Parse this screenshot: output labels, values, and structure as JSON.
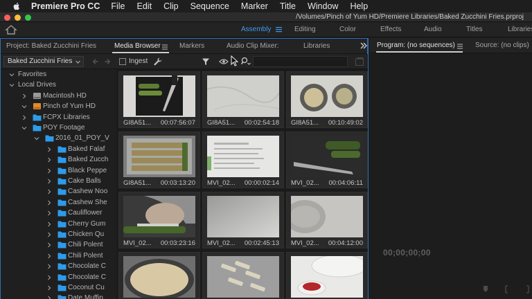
{
  "menubar": {
    "app_name": "Premiere Pro CC",
    "menus": [
      "File",
      "Edit",
      "Clip",
      "Sequence",
      "Marker",
      "Title",
      "Window",
      "Help"
    ]
  },
  "titlebar": {
    "path": "/Volumes/Pinch of Yum HD/Premiere Libraries/Baked Zucchini Fries.prproj"
  },
  "workspaces": {
    "tabs": [
      "Assembly",
      "Editing",
      "Color",
      "Effects",
      "Audio",
      "Titles",
      "Libraries"
    ],
    "active": "Assembly"
  },
  "project_panel": {
    "tabs": [
      "Project: Baked Zucchini Fries",
      "Media Browser",
      "Markers",
      "Audio Clip Mixer:",
      "Libraries"
    ],
    "active_tab": "Media Browser"
  },
  "media_browser": {
    "location": "Baked Zucchini Fries",
    "ingest_label": "Ingest",
    "search_value": ""
  },
  "tree": [
    {
      "label": "Favorites",
      "level": 0,
      "expanded": true,
      "type": "section"
    },
    {
      "label": "Local Drives",
      "level": 0,
      "expanded": true,
      "type": "section"
    },
    {
      "label": "Macintosh HD",
      "level": 1,
      "expanded": false,
      "type": "drive"
    },
    {
      "label": "Pinch of Yum HD",
      "level": 1,
      "expanded": true,
      "type": "drive-orange"
    },
    {
      "label": "FCPX Libraries",
      "level": 2,
      "expanded": false,
      "type": "folder"
    },
    {
      "label": "POY Footage",
      "level": 2,
      "expanded": true,
      "type": "folder"
    },
    {
      "label": "2016_01_POY_V",
      "level": 3,
      "expanded": true,
      "type": "folder"
    },
    {
      "label": "Baked Falaf",
      "level": 4,
      "expanded": false,
      "type": "folder"
    },
    {
      "label": "Baked Zucch",
      "level": 4,
      "expanded": false,
      "type": "folder"
    },
    {
      "label": "Black Peppe",
      "level": 4,
      "expanded": false,
      "type": "folder"
    },
    {
      "label": "Cake Balls",
      "level": 4,
      "expanded": false,
      "type": "folder"
    },
    {
      "label": "Cashew Noo",
      "level": 4,
      "expanded": false,
      "type": "folder"
    },
    {
      "label": "Cashew She",
      "level": 4,
      "expanded": false,
      "type": "folder"
    },
    {
      "label": "Cauliflower",
      "level": 4,
      "expanded": false,
      "type": "folder"
    },
    {
      "label": "Cherry Gum",
      "level": 4,
      "expanded": false,
      "type": "folder"
    },
    {
      "label": "Chicken Qu",
      "level": 4,
      "expanded": false,
      "type": "folder"
    },
    {
      "label": "Chili Polent",
      "level": 4,
      "expanded": false,
      "type": "folder"
    },
    {
      "label": "Chili Polent",
      "level": 4,
      "expanded": false,
      "type": "folder"
    },
    {
      "label": "Chocolate C",
      "level": 4,
      "expanded": false,
      "type": "folder"
    },
    {
      "label": "Chocolate C",
      "level": 4,
      "expanded": false,
      "type": "folder"
    },
    {
      "label": "Coconut Cu",
      "level": 4,
      "expanded": false,
      "type": "folder"
    },
    {
      "label": "Date Muffin",
      "level": 4,
      "expanded": false,
      "type": "folder"
    }
  ],
  "clips": [
    {
      "name": "GI8A51...",
      "duration": "00:07:56:07",
      "scene": "zucchini-knife"
    },
    {
      "name": "GI8A51...",
      "duration": "00:02:54:18",
      "scene": "marble"
    },
    {
      "name": "GI8A51...",
      "duration": "00:10:49:02",
      "scene": "bowls"
    },
    {
      "name": "GI8A51...",
      "duration": "00:03:13:20",
      "scene": "tray-fries"
    },
    {
      "name": "MVI_02...",
      "duration": "00:00:02:14",
      "scene": "recipe-paper"
    },
    {
      "name": "MVI_02...",
      "duration": "00:04:06:11",
      "scene": "knife-zucchini-dark"
    },
    {
      "name": "MVI_02...",
      "duration": "00:03:23:16",
      "scene": "cutting-hand"
    },
    {
      "name": "MVI_02...",
      "duration": "00:02:45:13",
      "scene": "blurry-light"
    },
    {
      "name": "MVI_02...",
      "duration": "00:04:12:00",
      "scene": "plate-blur"
    },
    {
      "name": "",
      "duration": "",
      "scene": "breadcrumbs-bowl"
    },
    {
      "name": "",
      "duration": "",
      "scene": "breaded-sticks"
    },
    {
      "name": "",
      "duration": "",
      "scene": "sauce-bowl"
    }
  ],
  "program_panel": {
    "tabs": [
      "Program: (no sequences)",
      "Source: (no clips)"
    ],
    "timecode": "00;00;00;00"
  },
  "colors": {
    "accent": "#3e9bf0",
    "panel_focus": "#2c6fb8",
    "folder": "#2d9bea"
  }
}
